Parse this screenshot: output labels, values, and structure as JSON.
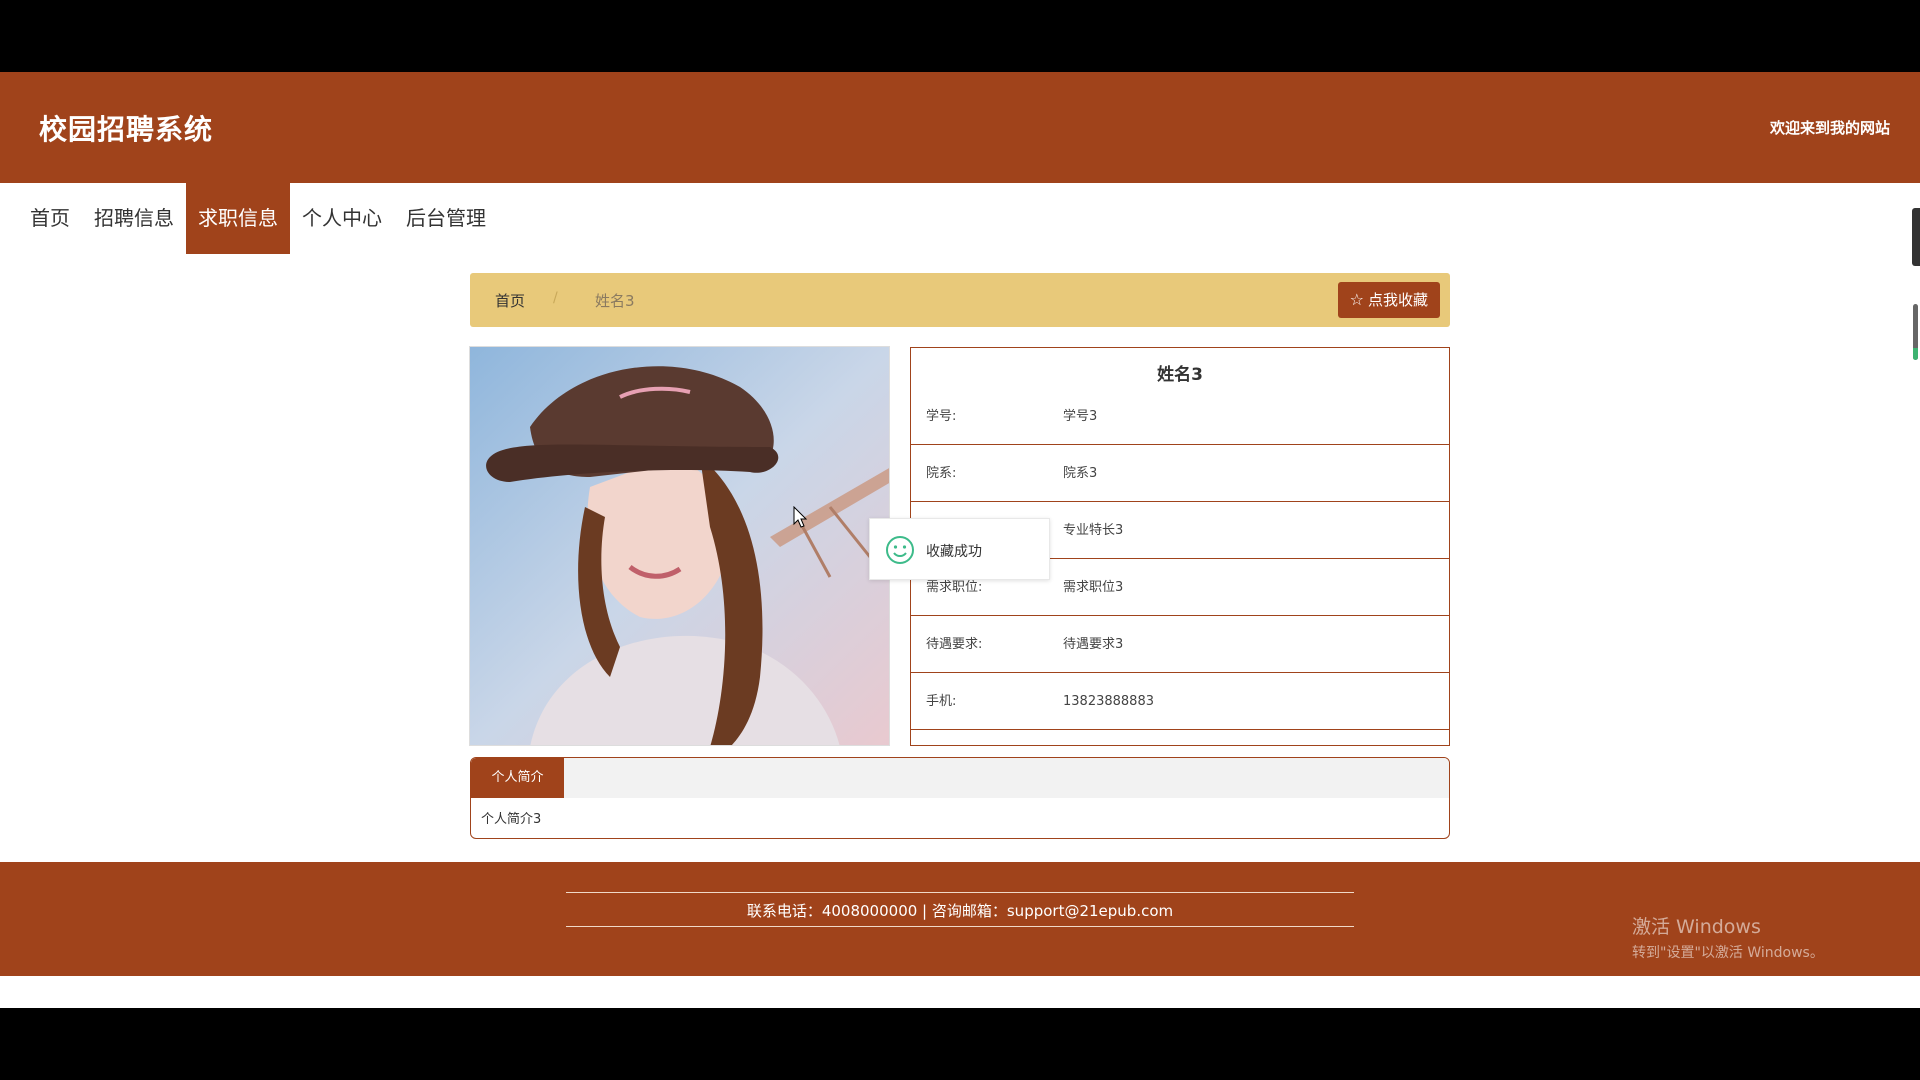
{
  "header": {
    "site_title": "校园招聘系统",
    "welcome": "欢迎来到我的网站"
  },
  "nav": {
    "items": [
      {
        "label": "首页"
      },
      {
        "label": "招聘信息"
      },
      {
        "label": "求职信息",
        "active": true
      },
      {
        "label": "个人中心"
      },
      {
        "label": "后台管理"
      }
    ]
  },
  "breadcrumb": {
    "home": "首页",
    "separator": "/",
    "current": "姓名3",
    "favorite_button": "点我收藏",
    "favorite_icon": "star-icon"
  },
  "profile": {
    "name": "姓名3",
    "rows": [
      {
        "label": "学号:",
        "value": "学号3"
      },
      {
        "label": "院系:",
        "value": "院系3"
      },
      {
        "label": "",
        "value": "专业特长3"
      },
      {
        "label": "需求职位:",
        "value": "需求职位3"
      },
      {
        "label": "待遇要求:",
        "value": "待遇要求3"
      },
      {
        "label": "手机:",
        "value": "13823888883"
      }
    ]
  },
  "toast": {
    "message": "收藏成功",
    "icon": "smile-icon"
  },
  "intro": {
    "tab_label": "个人简介",
    "content": "个人简介3"
  },
  "footer": {
    "contact": "联系电话：4008000000 | 咨询邮箱：support@21epub.com"
  },
  "watermark": {
    "title": "激活 Windows",
    "subtitle": "转到\"设置\"以激活 Windows。"
  },
  "colors": {
    "brand": "#a0431b",
    "breadcrumb_bg": "#e8c97a"
  }
}
